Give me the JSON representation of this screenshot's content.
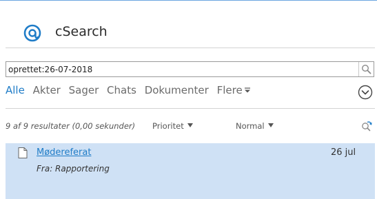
{
  "app": {
    "title": "cSearch",
    "logo_icon": "at-sign-icon",
    "accent_color": "#1f7cc7"
  },
  "search": {
    "query": "oprettet:26-07-2018",
    "button_icon": "magnifier-icon"
  },
  "tabs": [
    {
      "label": "Alle",
      "active": true
    },
    {
      "label": "Akter",
      "active": false
    },
    {
      "label": "Sager",
      "active": false
    },
    {
      "label": "Chats",
      "active": false
    },
    {
      "label": "Dokumenter",
      "active": false
    },
    {
      "label": "Flere",
      "active": false
    }
  ],
  "tabs_more_icon": "chevron-down-circle-icon",
  "status": {
    "result_count": "9 af 9 resultater (0,00 sekunder)",
    "sort_label": "Prioritet",
    "order_label": "Normal",
    "refresh_icon": "refresh-search-icon"
  },
  "results": [
    {
      "title": "Mødereferat",
      "date": "26 jul",
      "from": "Fra: Rapportering",
      "icon": "document-icon",
      "selected": true
    }
  ]
}
